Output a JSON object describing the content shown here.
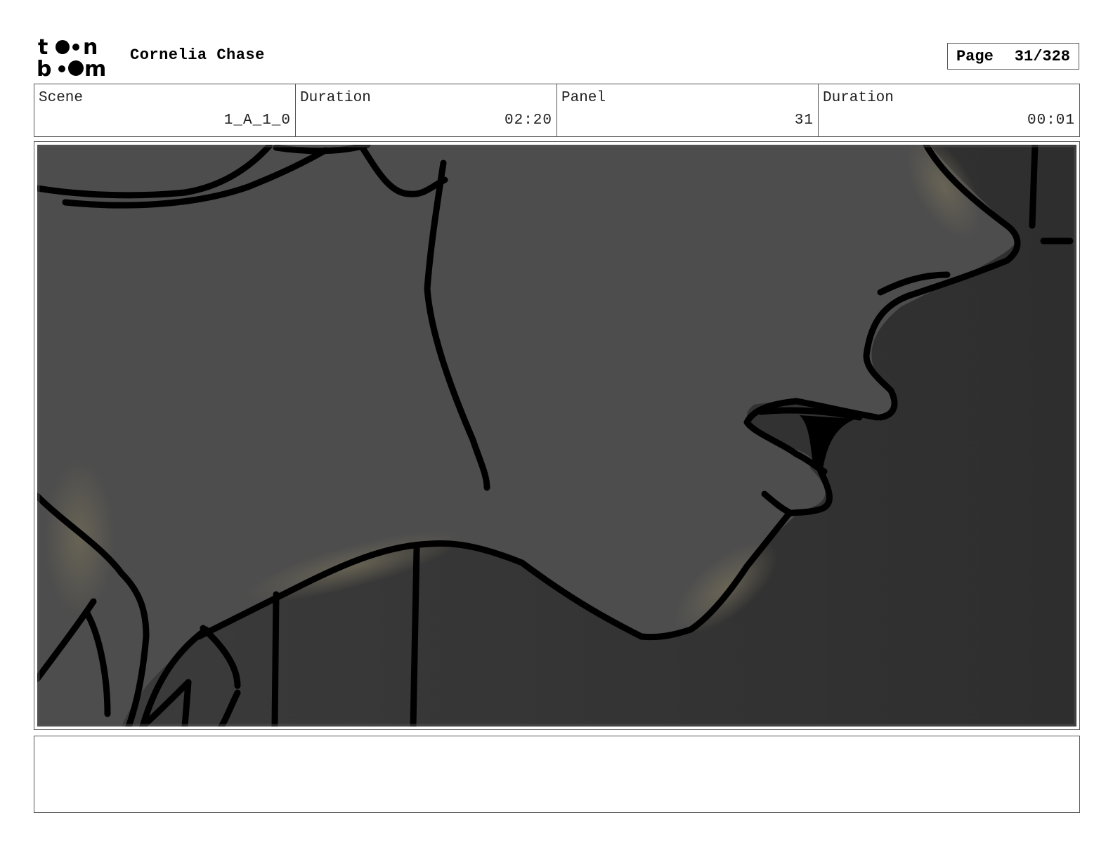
{
  "header": {
    "logo_text": [
      "t",
      "n",
      "b",
      "m"
    ],
    "project_title": "Cornelia Chase",
    "page_label": "Page",
    "page_number": "31/328"
  },
  "info": {
    "scene_label": "Scene",
    "scene_value": "1_A_1_0",
    "scene_duration_label": "Duration",
    "scene_duration_value": "02:20",
    "panel_label": "Panel",
    "panel_value": "31",
    "panel_duration_label": "Duration",
    "panel_duration_value": "00:01"
  },
  "panel": {
    "image_description_name": "storyboard-sketch",
    "colors": {
      "background_dark": "#333333",
      "face_fill": "#4d4d4d",
      "glow": "#6b6656",
      "ink": "#000000"
    }
  },
  "notes": {
    "text": ""
  }
}
